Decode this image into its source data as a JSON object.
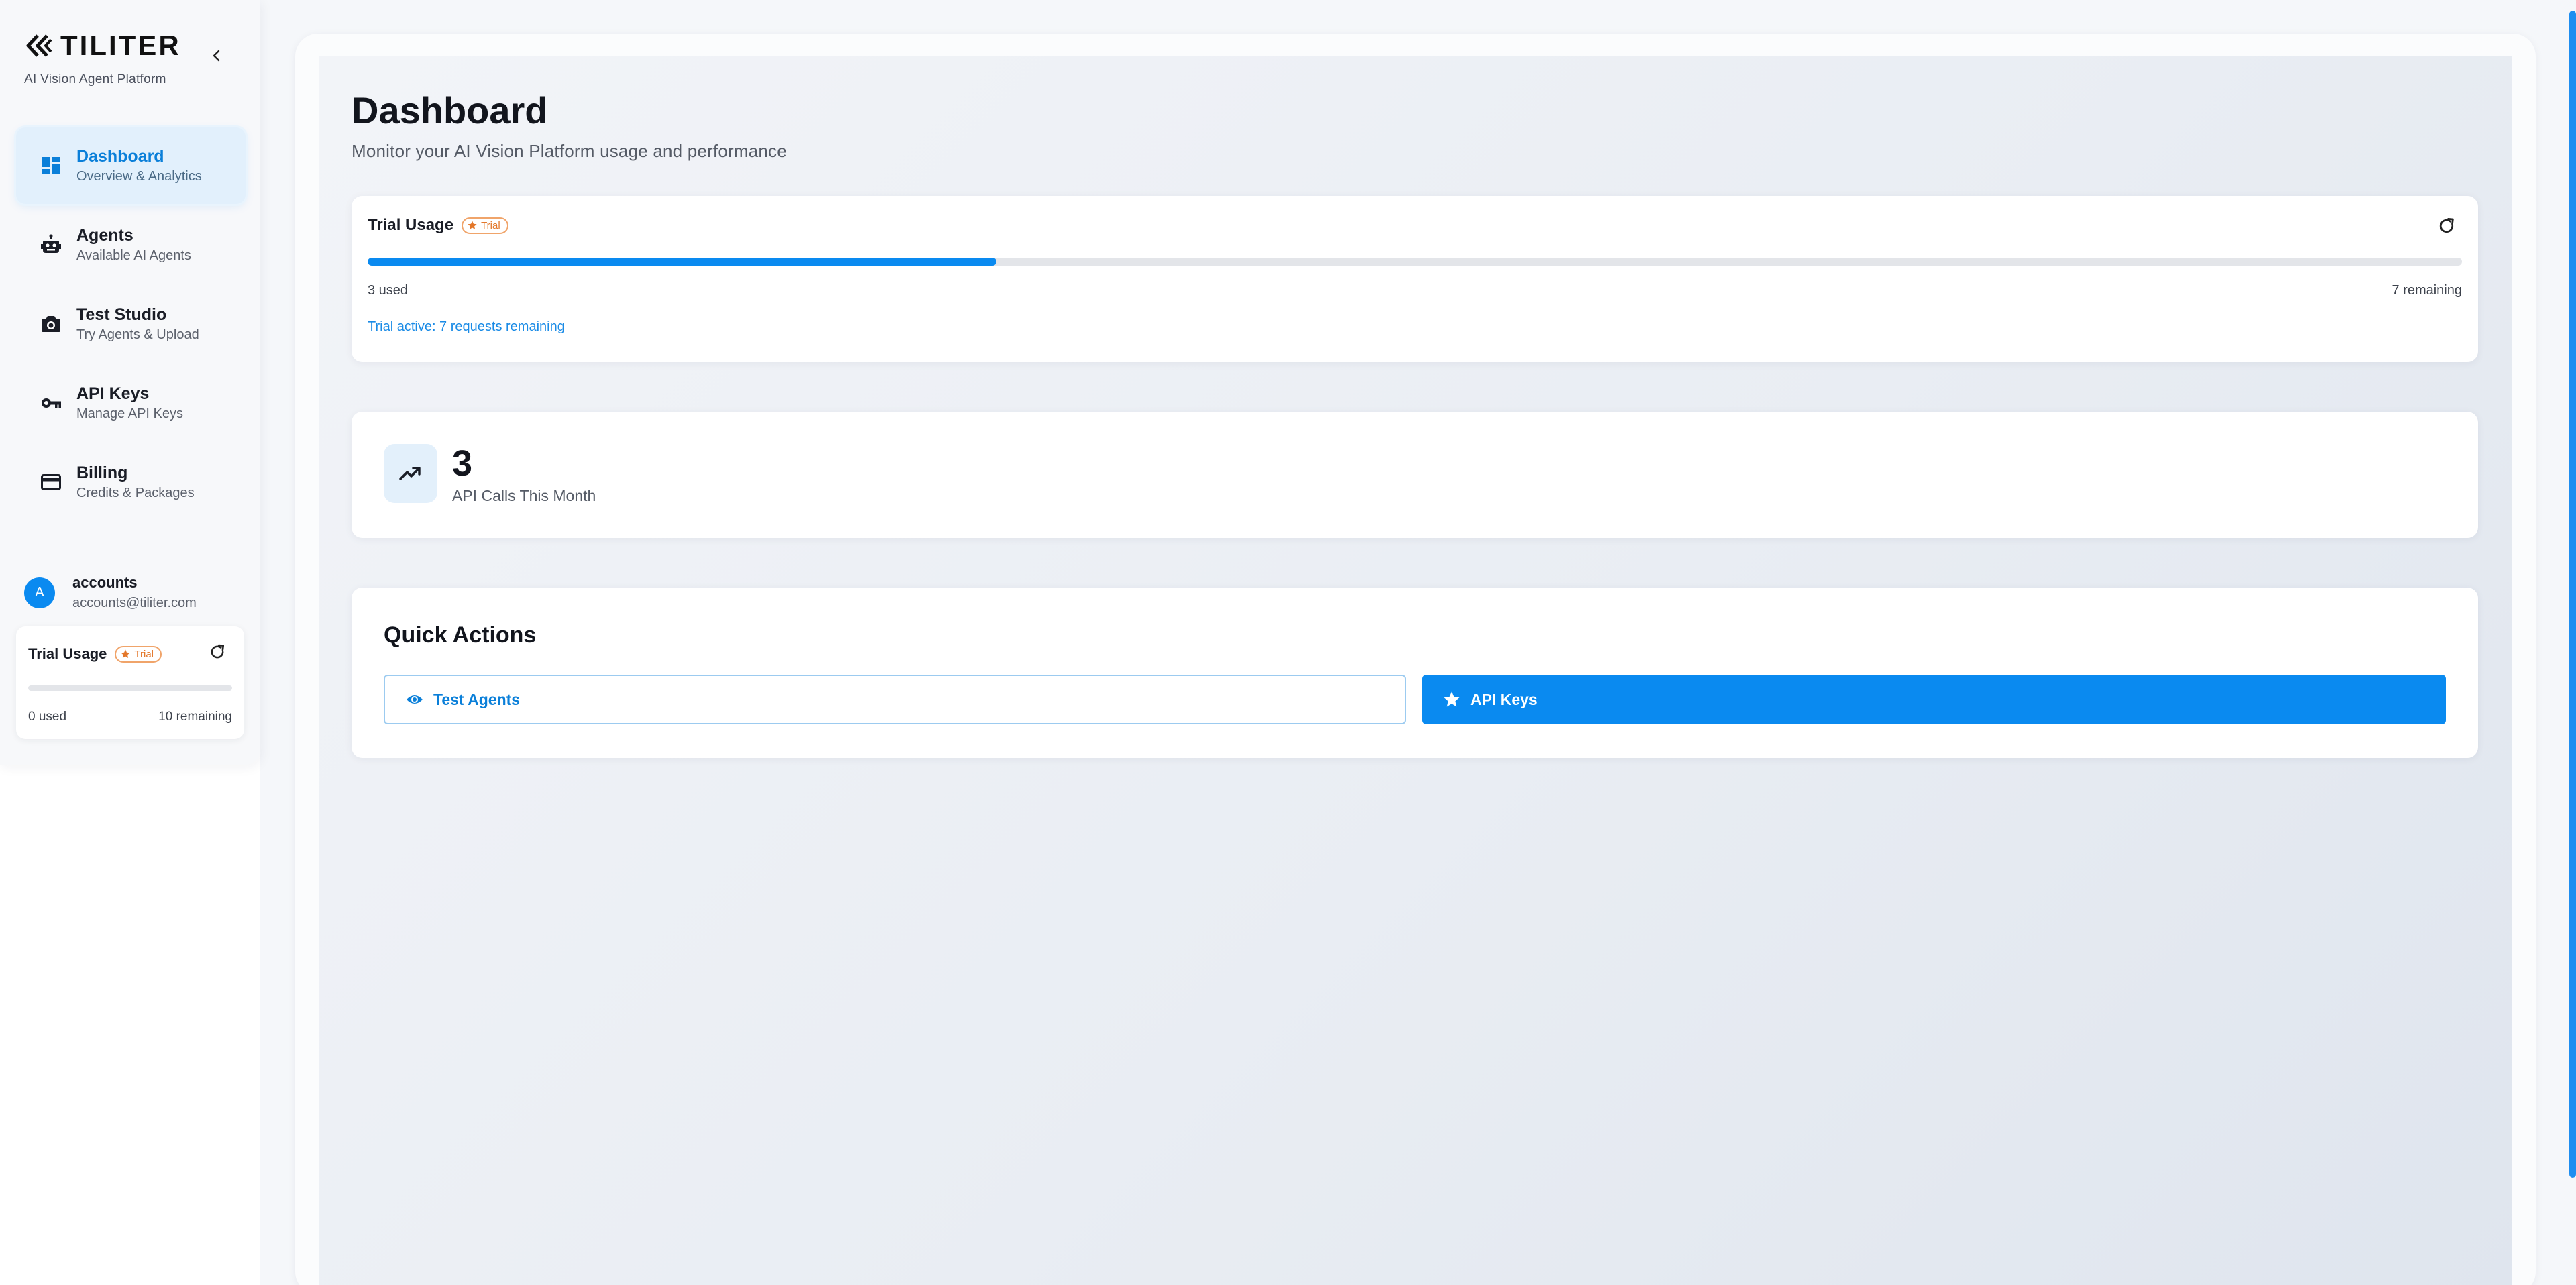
{
  "brand": {
    "name": "TILITER",
    "tagline": "AI Vision Agent Platform",
    "logo_icon": "double-chevron-logo"
  },
  "sidebar": {
    "collapse_icon": "chevron-left-icon",
    "items": [
      {
        "title": "Dashboard",
        "desc": "Overview & Analytics",
        "icon": "dashboard-icon",
        "active": true
      },
      {
        "title": "Agents",
        "desc": "Available AI Agents",
        "icon": "robot-icon",
        "active": false
      },
      {
        "title": "Test Studio",
        "desc": "Try Agents & Upload",
        "icon": "camera-icon",
        "active": false
      },
      {
        "title": "API Keys",
        "desc": "Manage API Keys",
        "icon": "key-icon",
        "active": false
      },
      {
        "title": "Billing",
        "desc": "Credits & Packages",
        "icon": "credit-card-icon",
        "active": false
      }
    ],
    "user": {
      "initial": "A",
      "name": "accounts",
      "email": "accounts@tiliter.com"
    },
    "trial": {
      "title": "Trial Usage",
      "badge": "Trial",
      "used_text": "0 used",
      "remaining_text": "10 remaining",
      "progress": 0
    }
  },
  "main": {
    "title": "Dashboard",
    "subtitle": "Monitor your AI Vision Platform usage and performance",
    "trial": {
      "title": "Trial Usage",
      "badge": "Trial",
      "used_text": "3 used",
      "remaining_text": "7 remaining",
      "status": "Trial active: 7 requests remaining",
      "progress": 0.3
    },
    "stat": {
      "value": "3",
      "label": "API Calls This Month",
      "icon": "trending-up-icon"
    },
    "quick_actions": {
      "title": "Quick Actions",
      "buttons": [
        {
          "label": "Test Agents",
          "icon": "eye-icon"
        },
        {
          "label": "API Keys",
          "icon": "star-icon"
        }
      ]
    }
  },
  "colors": {
    "accent": "#0a8af0",
    "badge_orange": "#e3772a"
  }
}
